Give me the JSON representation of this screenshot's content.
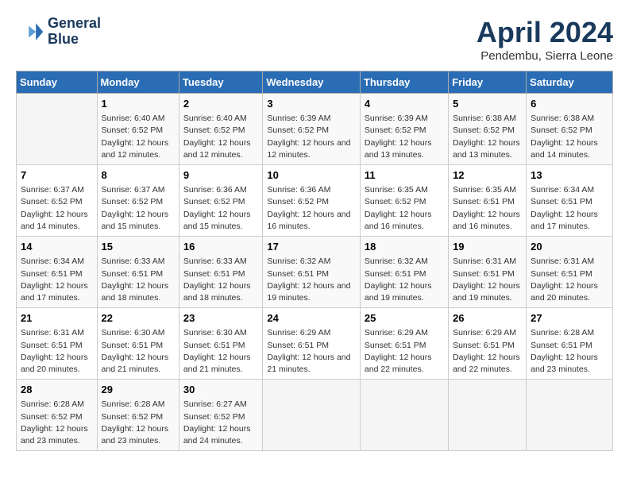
{
  "header": {
    "logo_line1": "General",
    "logo_line2": "Blue",
    "month": "April 2024",
    "location": "Pendembu, Sierra Leone"
  },
  "calendar": {
    "weekdays": [
      "Sunday",
      "Monday",
      "Tuesday",
      "Wednesday",
      "Thursday",
      "Friday",
      "Saturday"
    ],
    "rows": [
      [
        {
          "day": "",
          "info": ""
        },
        {
          "day": "1",
          "info": "Sunrise: 6:40 AM\nSunset: 6:52 PM\nDaylight: 12 hours\nand 12 minutes."
        },
        {
          "day": "2",
          "info": "Sunrise: 6:40 AM\nSunset: 6:52 PM\nDaylight: 12 hours\nand 12 minutes."
        },
        {
          "day": "3",
          "info": "Sunrise: 6:39 AM\nSunset: 6:52 PM\nDaylight: 12 hours\nand 12 minutes."
        },
        {
          "day": "4",
          "info": "Sunrise: 6:39 AM\nSunset: 6:52 PM\nDaylight: 12 hours\nand 13 minutes."
        },
        {
          "day": "5",
          "info": "Sunrise: 6:38 AM\nSunset: 6:52 PM\nDaylight: 12 hours\nand 13 minutes."
        },
        {
          "day": "6",
          "info": "Sunrise: 6:38 AM\nSunset: 6:52 PM\nDaylight: 12 hours\nand 14 minutes."
        }
      ],
      [
        {
          "day": "7",
          "info": "Sunrise: 6:37 AM\nSunset: 6:52 PM\nDaylight: 12 hours\nand 14 minutes."
        },
        {
          "day": "8",
          "info": "Sunrise: 6:37 AM\nSunset: 6:52 PM\nDaylight: 12 hours\nand 15 minutes."
        },
        {
          "day": "9",
          "info": "Sunrise: 6:36 AM\nSunset: 6:52 PM\nDaylight: 12 hours\nand 15 minutes."
        },
        {
          "day": "10",
          "info": "Sunrise: 6:36 AM\nSunset: 6:52 PM\nDaylight: 12 hours\nand 16 minutes."
        },
        {
          "day": "11",
          "info": "Sunrise: 6:35 AM\nSunset: 6:52 PM\nDaylight: 12 hours\nand 16 minutes."
        },
        {
          "day": "12",
          "info": "Sunrise: 6:35 AM\nSunset: 6:51 PM\nDaylight: 12 hours\nand 16 minutes."
        },
        {
          "day": "13",
          "info": "Sunrise: 6:34 AM\nSunset: 6:51 PM\nDaylight: 12 hours\nand 17 minutes."
        }
      ],
      [
        {
          "day": "14",
          "info": "Sunrise: 6:34 AM\nSunset: 6:51 PM\nDaylight: 12 hours\nand 17 minutes."
        },
        {
          "day": "15",
          "info": "Sunrise: 6:33 AM\nSunset: 6:51 PM\nDaylight: 12 hours\nand 18 minutes."
        },
        {
          "day": "16",
          "info": "Sunrise: 6:33 AM\nSunset: 6:51 PM\nDaylight: 12 hours\nand 18 minutes."
        },
        {
          "day": "17",
          "info": "Sunrise: 6:32 AM\nSunset: 6:51 PM\nDaylight: 12 hours\nand 19 minutes."
        },
        {
          "day": "18",
          "info": "Sunrise: 6:32 AM\nSunset: 6:51 PM\nDaylight: 12 hours\nand 19 minutes."
        },
        {
          "day": "19",
          "info": "Sunrise: 6:31 AM\nSunset: 6:51 PM\nDaylight: 12 hours\nand 19 minutes."
        },
        {
          "day": "20",
          "info": "Sunrise: 6:31 AM\nSunset: 6:51 PM\nDaylight: 12 hours\nand 20 minutes."
        }
      ],
      [
        {
          "day": "21",
          "info": "Sunrise: 6:31 AM\nSunset: 6:51 PM\nDaylight: 12 hours\nand 20 minutes."
        },
        {
          "day": "22",
          "info": "Sunrise: 6:30 AM\nSunset: 6:51 PM\nDaylight: 12 hours\nand 21 minutes."
        },
        {
          "day": "23",
          "info": "Sunrise: 6:30 AM\nSunset: 6:51 PM\nDaylight: 12 hours\nand 21 minutes."
        },
        {
          "day": "24",
          "info": "Sunrise: 6:29 AM\nSunset: 6:51 PM\nDaylight: 12 hours\nand 21 minutes."
        },
        {
          "day": "25",
          "info": "Sunrise: 6:29 AM\nSunset: 6:51 PM\nDaylight: 12 hours\nand 22 minutes."
        },
        {
          "day": "26",
          "info": "Sunrise: 6:29 AM\nSunset: 6:51 PM\nDaylight: 12 hours\nand 22 minutes."
        },
        {
          "day": "27",
          "info": "Sunrise: 6:28 AM\nSunset: 6:51 PM\nDaylight: 12 hours\nand 23 minutes."
        }
      ],
      [
        {
          "day": "28",
          "info": "Sunrise: 6:28 AM\nSunset: 6:52 PM\nDaylight: 12 hours\nand 23 minutes."
        },
        {
          "day": "29",
          "info": "Sunrise: 6:28 AM\nSunset: 6:52 PM\nDaylight: 12 hours\nand 23 minutes."
        },
        {
          "day": "30",
          "info": "Sunrise: 6:27 AM\nSunset: 6:52 PM\nDaylight: 12 hours\nand 24 minutes."
        },
        {
          "day": "",
          "info": ""
        },
        {
          "day": "",
          "info": ""
        },
        {
          "day": "",
          "info": ""
        },
        {
          "day": "",
          "info": ""
        }
      ]
    ]
  }
}
